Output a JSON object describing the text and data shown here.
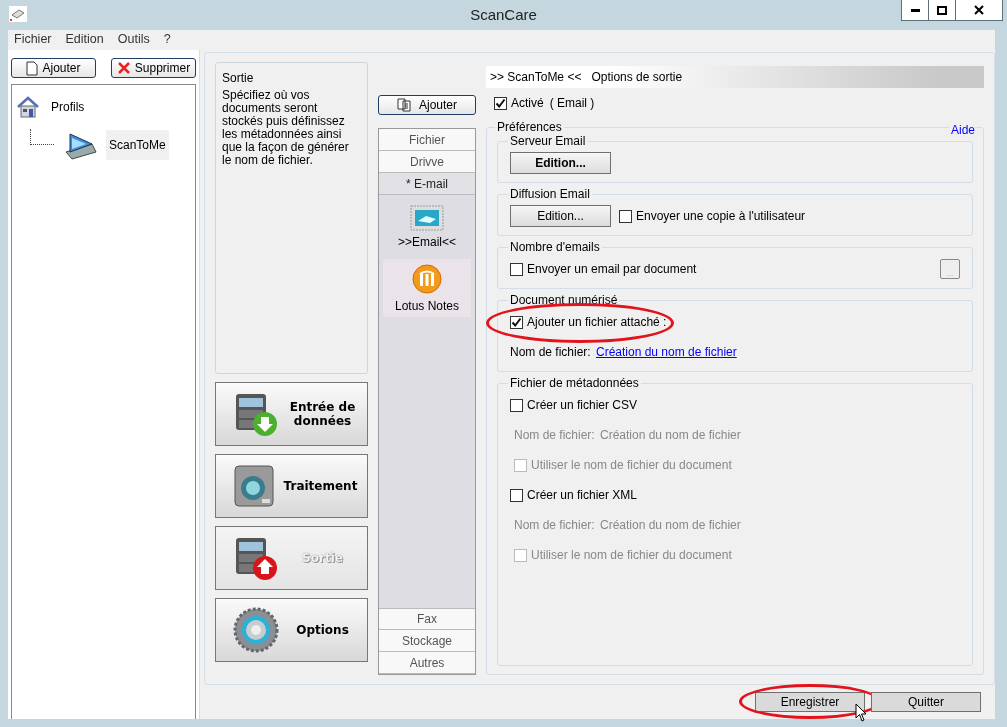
{
  "window": {
    "title": "ScanCare"
  },
  "menu": [
    "Fichier",
    "Edition",
    "Outils",
    "?"
  ],
  "profiles": {
    "buttons": [
      {
        "label": "Ajouter",
        "kind": "add"
      },
      {
        "label": "Supprimer",
        "kind": "delete"
      }
    ],
    "tree": [
      {
        "label": "Profils",
        "kind": "home",
        "selected": false,
        "children": [
          {
            "label": "ScanToMe",
            "kind": "scanner",
            "selected": true
          }
        ]
      }
    ]
  },
  "step_info": {
    "title": "Sortie",
    "text": "Spécifiez où vos documents seront stockés puis définissez les métadonnées ainsi que la façon de générer le nom de fichier."
  },
  "steps": [
    {
      "label": "Entrée de données",
      "kind": "input",
      "selected": false
    },
    {
      "label": "Traitement",
      "kind": "process",
      "selected": false
    },
    {
      "label": "Sortie",
      "kind": "output",
      "selected": true
    },
    {
      "label": "Options",
      "kind": "options",
      "selected": false
    }
  ],
  "output_types": {
    "add_button": "Ajouter",
    "top_tabs": [
      {
        "label": "Fichier",
        "selected": false
      },
      {
        "label": "Drivve",
        "selected": false
      },
      {
        "label": "* E-mail",
        "selected": true
      }
    ],
    "plugins": [
      {
        "label": ">>Email<<",
        "kind": "email",
        "highlighted": false
      },
      {
        "label": "Lotus Notes",
        "kind": "lotus",
        "highlighted": true
      }
    ],
    "bottom_tabs": [
      {
        "label": "Fax",
        "selected": false
      },
      {
        "label": "Stockage",
        "selected": false
      },
      {
        "label": "Autres",
        "selected": false
      }
    ]
  },
  "options": {
    "header": {
      "profile": ">> ScanToMe <<",
      "title": "Options de sortie"
    },
    "enabled": {
      "label": "Activé",
      "suffix": "( Email )",
      "checked": true
    },
    "preferences": {
      "title": "Préférences",
      "help_link": "Aide",
      "groups": [
        {
          "title": "Serveur Email",
          "rows": [
            [
              {
                "kind": "button",
                "label": "Edition...",
                "bold": true
              }
            ]
          ]
        },
        {
          "title": "Diffusion Email",
          "rows": [
            [
              {
                "kind": "button",
                "label": "Edition...",
                "bold": false
              },
              {
                "kind": "checkbox",
                "label": "Envoyer une copie à l'utilisateur",
                "checked": false,
                "disabled": false
              }
            ]
          ]
        },
        {
          "title": "Nombre d'emails",
          "rows": [
            [
              {
                "kind": "checkbox",
                "label": "Envoyer un email par document",
                "checked": false,
                "disabled": false
              },
              {
                "kind": "small-button",
                "label": "...",
                "disabled": true
              }
            ]
          ]
        },
        {
          "title": "Document numérisé",
          "rows": [
            [
              {
                "kind": "checkbox",
                "label": "Ajouter un fichier attaché :",
                "checked": true,
                "disabled": false,
                "circled": true
              }
            ],
            [
              {
                "kind": "file-name",
                "label": "Nom de fichier:",
                "value": "Création du nom de fichier",
                "disabled": false
              }
            ]
          ]
        },
        {
          "title": "Fichier de métadonnées",
          "rows": [
            [
              {
                "kind": "checkbox",
                "label": "Créer un fichier CSV",
                "checked": false,
                "disabled": false
              }
            ],
            [
              {
                "kind": "file-name",
                "label": "Nom de fichier:",
                "value": "Création du nom de fichier",
                "disabled": true
              }
            ],
            [
              {
                "kind": "checkbox",
                "label": "Utiliser le nom de fichier du document",
                "checked": false,
                "disabled": true
              }
            ],
            [
              {
                "kind": "checkbox",
                "label": "Créer un fichier XML",
                "checked": false,
                "disabled": false
              }
            ],
            [
              {
                "kind": "file-name",
                "label": "Nom de fichier:",
                "value": "Création du nom de fichier",
                "disabled": true
              }
            ],
            [
              {
                "kind": "checkbox",
                "label": "Utiliser le nom de fichier du document",
                "checked": false,
                "disabled": true
              }
            ]
          ]
        }
      ]
    }
  },
  "footer": [
    {
      "label": "Enregistrer",
      "circled": true,
      "pointer_over": true
    },
    {
      "label": "Quitter",
      "circled": false,
      "pointer_over": false
    }
  ]
}
